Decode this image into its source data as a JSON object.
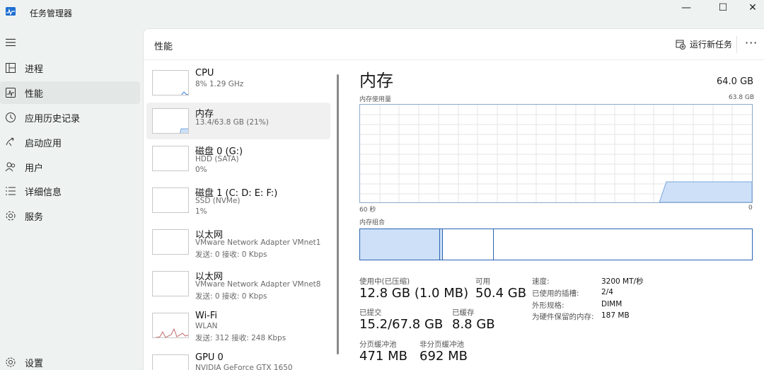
{
  "window": {
    "title": "任务管理器",
    "controls": {
      "minimize": "—",
      "maximize": "☐",
      "close": "✕"
    }
  },
  "nav": {
    "items": [
      {
        "label": "进程",
        "icon": "processes-icon"
      },
      {
        "label": "性能",
        "icon": "performance-icon",
        "active": true
      },
      {
        "label": "应用历史记录",
        "icon": "app-history-icon"
      },
      {
        "label": "启动应用",
        "icon": "startup-icon"
      },
      {
        "label": "用户",
        "icon": "users-icon"
      },
      {
        "label": "详细信息",
        "icon": "details-icon"
      },
      {
        "label": "服务",
        "icon": "services-icon"
      }
    ],
    "settings_label": "设置"
  },
  "header": {
    "title": "性能",
    "run_task_label": "运行新任务",
    "more": "···"
  },
  "perf_list": [
    {
      "name": "CPU",
      "line1": "8%  1.29 GHz",
      "line2": ""
    },
    {
      "name": "内存",
      "line1": "13.4/63.8 GB (21%)",
      "line2": "",
      "active": true
    },
    {
      "name": "磁盘 0 (G:)",
      "line1": "HDD (SATA)",
      "line2": "0%"
    },
    {
      "name": "磁盘 1 (C: D: E: F:)",
      "line1": "SSD (NVMe)",
      "line2": "1%"
    },
    {
      "name": "以太网",
      "line1": "VMware Network Adapter VMnet1",
      "line2": "发送: 0 接收: 0 Kbps"
    },
    {
      "name": "以太网",
      "line1": "VMware Network Adapter VMnet8",
      "line2": "发送: 0 接收: 0 Kbps"
    },
    {
      "name": "Wi-Fi",
      "line1": "WLAN",
      "line2": "发送: 312 接收: 248 Kbps"
    },
    {
      "name": "GPU 0",
      "line1": "NVIDIA GeForce GTX 1650",
      "line2": ""
    }
  ],
  "detail": {
    "title": "内存",
    "total": "64.0 GB",
    "usage_label": "内存使用量",
    "usage_max": "63.8 GB",
    "axis_left": "60 秒",
    "axis_right": "0",
    "composition_label": "内存组合",
    "usage_fraction": 0.21,
    "stats": {
      "in_use_label": "使用中(已压缩)",
      "in_use_value": "12.8 GB (1.0 MB)",
      "available_label": "可用",
      "available_value": "50.4 GB",
      "committed_label": "已提交",
      "committed_value": "15.2/67.8 GB",
      "cached_label": "已缓存",
      "cached_value": "8.8 GB",
      "paged_label": "分页缓冲池",
      "paged_value": "471 MB",
      "nonpaged_label": "非分页缓冲池",
      "nonpaged_value": "692 MB"
    },
    "specs": [
      {
        "key": "速度:",
        "value": "3200 MT/秒"
      },
      {
        "key": "已使用的插槽:",
        "value": "2/4"
      },
      {
        "key": "外形规格:",
        "value": "DIMM"
      },
      {
        "key": "为硬件保留的内存:",
        "value": "187 MB"
      }
    ]
  },
  "colors": {
    "accent": "#2b63b5",
    "graph_fill": "#cde0f7",
    "graph_line": "#7aa6dc",
    "grid": "#e6e6e6"
  }
}
